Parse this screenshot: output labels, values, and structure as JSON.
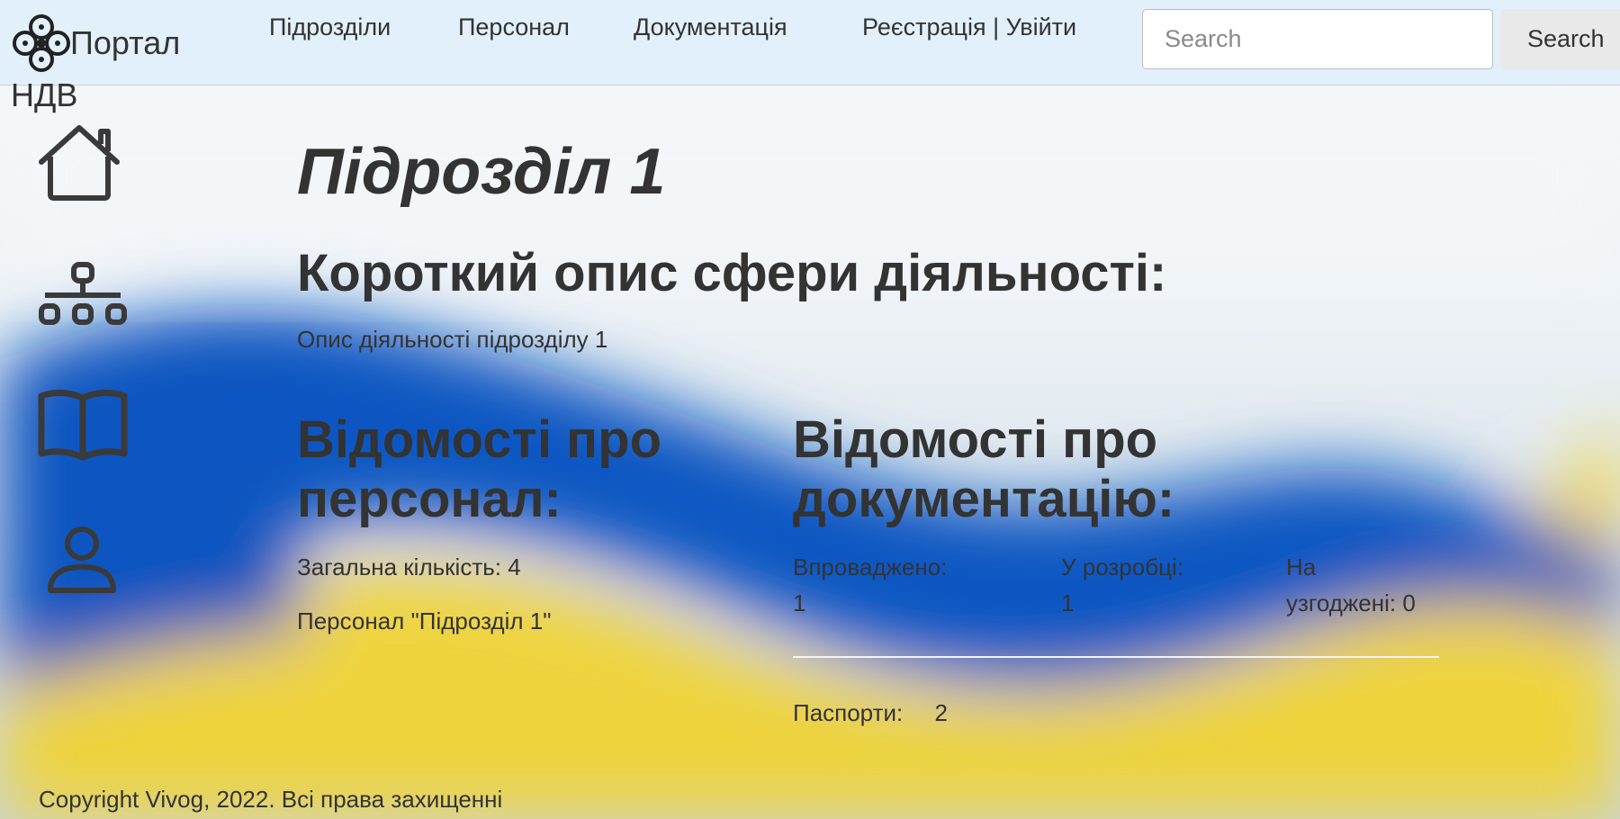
{
  "brand": {
    "name": "Портал",
    "sub": "НДВ"
  },
  "nav": {
    "items": [
      {
        "label": "Підрозділи"
      },
      {
        "label": "Персонал"
      },
      {
        "label": "Документація"
      },
      {
        "label": "Реєстрація | Увійти"
      }
    ]
  },
  "search": {
    "placeholder": "Search",
    "button_label": "Search"
  },
  "sidebar": {
    "icons": [
      "home-icon",
      "org-structure-icon",
      "open-book-icon",
      "user-icon"
    ]
  },
  "main": {
    "title": "Підрозділ 1",
    "activity_heading": "Короткий опис сфери діяльності:",
    "activity_text": "Опис діяльності підрозділу 1",
    "staff": {
      "heading": "Відомості про персонал:",
      "heading_line1": "Відомості про",
      "heading_line2": "персонал:",
      "total_label": "Загальна кількість: 4",
      "link_label": "Персонал \"Підрозділ 1\""
    },
    "docs": {
      "heading_line1": "Відомості про",
      "heading_line2": "документацію:",
      "stats": [
        {
          "line1": "Впроваджено:",
          "line2": "1"
        },
        {
          "line1": "У розробці:",
          "line2": "1"
        },
        {
          "line1": "На",
          "line2": "узгоджені: 0"
        }
      ],
      "passports_label": "Паспорти:",
      "passports_value": "2"
    }
  },
  "footer": {
    "text": "Copyright Vivog, 2022. Всі права захищенні"
  },
  "colors": {
    "flag_blue": "#0a57c2",
    "flag_yellow": "#f5d21c",
    "navbar": "#e2f0fb"
  }
}
